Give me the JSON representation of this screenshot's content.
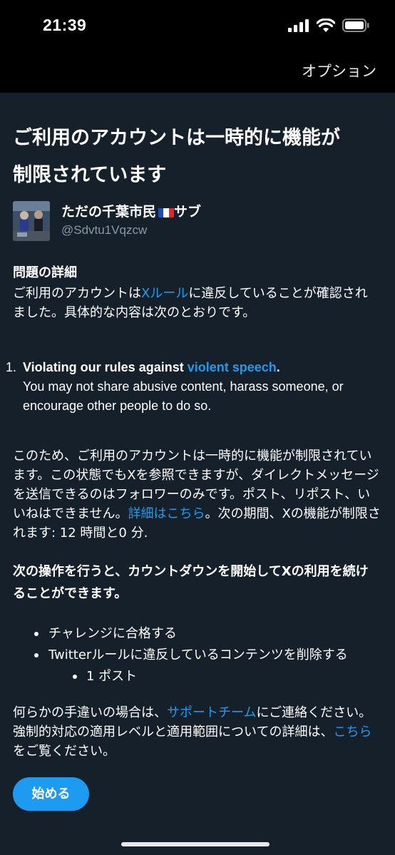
{
  "status_bar": {
    "time": "21:39"
  },
  "nav": {
    "options_label": "オプション"
  },
  "page": {
    "title_line1": "ご利用のアカウントは一時的に機能が",
    "title_line2": "制限されています"
  },
  "account": {
    "name": "ただの千葉市民",
    "name_suffix": "サブ",
    "handle": "@Sdvtu1Vqzcw"
  },
  "details": {
    "heading": "問題の詳細",
    "pre": "ご利用のアカウントは",
    "rules_link": "Xルール",
    "post": "に違反していることが確認されました。具体的な内容は次のとおりです。"
  },
  "violation": {
    "number": "1.",
    "title_prefix": "Violating our rules against ",
    "title_link": "violent speech",
    "title_suffix": ".",
    "body": "You may not share abusive content, harass someone, or encourage other people to do so."
  },
  "restriction": {
    "pre": "このため、ご利用のアカウントは一時的に機能が制限されています。この状態でもXを参照できますが、ダイレクトメッセージを送信できるのはフォロワーのみです。ポスト、リポスト、いいねはできません。",
    "link": "詳細はこちら",
    "post": "。次の期間、Xの機能が制限されます: 12 時間と0 分."
  },
  "countdown": {
    "text": "次の操作を行うと、カウントダウンを開始してXの利用を続けることができます。"
  },
  "actions": {
    "item1": "チャレンジに合格する",
    "item2": "Twitterルールに違反しているコンテンツを削除する",
    "sub_item": "1 ポスト"
  },
  "contact": {
    "pre": "何らかの手違いの場合は、",
    "support_link": "サポートチーム",
    "mid": "にご連絡ください。強制的対応の適用レベルと適用範囲についての詳細は、",
    "here_link": "こちら",
    "post": "をご覧ください。"
  },
  "button": {
    "start_label": "始める"
  },
  "colors": {
    "background": "#15202b",
    "accent": "#1d9bf0",
    "muted": "#8b98a5"
  }
}
